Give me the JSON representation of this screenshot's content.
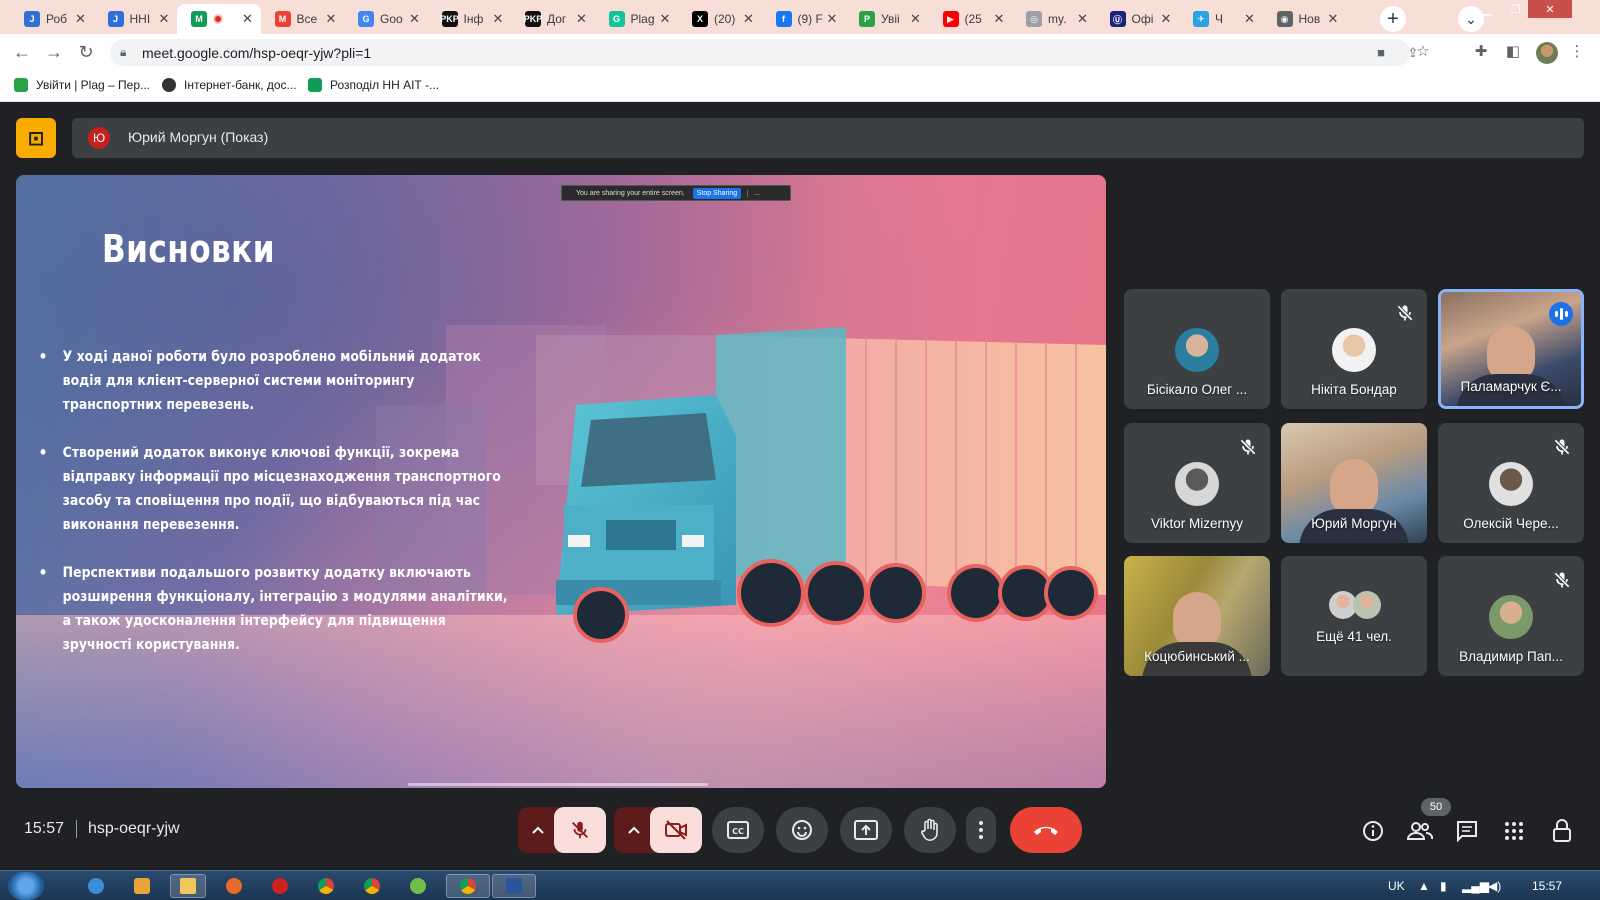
{
  "browser": {
    "tabs": [
      {
        "title": "Роб",
        "favicon": "jira-icon",
        "color": "#2f6fd6",
        "glyph": "J"
      },
      {
        "title": "ННІ",
        "favicon": "jira-icon",
        "color": "#2f6fd6",
        "glyph": "J"
      },
      {
        "title": "",
        "favicon": "meet-icon",
        "color": "#0f9d58",
        "glyph": "M",
        "recording": true
      },
      {
        "title": "Все",
        "favicon": "gmail-icon",
        "color": "#ea4335",
        "glyph": "M"
      },
      {
        "title": "Goo",
        "favicon": "google-translate-icon",
        "color": "#4285f4",
        "glyph": "G"
      },
      {
        "title": "Інф",
        "favicon": "pkp-icon",
        "color": "#111111",
        "glyph": "PKP"
      },
      {
        "title": "Дог",
        "favicon": "pkp-icon",
        "color": "#111111",
        "glyph": "PKP"
      },
      {
        "title": "Plag",
        "favicon": "grammarly-icon",
        "color": "#15c39a",
        "glyph": "G"
      },
      {
        "title": "(20)",
        "favicon": "x-icon",
        "color": "#000000",
        "glyph": "X"
      },
      {
        "title": "(9) F",
        "favicon": "facebook-icon",
        "color": "#1877f2",
        "glyph": "f"
      },
      {
        "title": "Увіі",
        "favicon": "plag-icon",
        "color": "#2aa245",
        "glyph": "P"
      },
      {
        "title": "(25",
        "favicon": "youtube-icon",
        "color": "#ff0000",
        "glyph": "▶"
      },
      {
        "title": "my.",
        "favicon": "globe-icon",
        "color": "#9aa0a6",
        "glyph": "◎"
      },
      {
        "title": "Офі",
        "favicon": "ukraine-icon",
        "color": "#1a237e",
        "glyph": "Ⓤ"
      },
      {
        "title": "Ч",
        "favicon": "telegram-icon",
        "color": "#2aa3e0",
        "glyph": "✈"
      },
      {
        "title": "Нов",
        "favicon": "chrome-icon",
        "color": "#5f6368",
        "glyph": "◉"
      }
    ],
    "url": "meet.google.com/hsp-oeqr-yjw?pli=1",
    "bookmarks": [
      {
        "label": "Увійти | Plag – Пер...",
        "icon": "plag-icon",
        "color": "#2aa245"
      },
      {
        "label": "Інтернет-банк, дос...",
        "icon": "bank24-icon",
        "color": "#333333"
      },
      {
        "label": "Розподіл НН АІТ -...",
        "icon": "sheets-icon",
        "color": "#0f9d58"
      }
    ]
  },
  "meet": {
    "presenter_initial": "Ю",
    "presenter_label": "Юрий Моргун (Показ)",
    "share_banner": {
      "text": "You are sharing your entire screen.",
      "stop": "Stop Sharing",
      "hide": "..."
    },
    "slide": {
      "title": "Висновки",
      "bullets": [
        "У ході даної роботи було розроблено мобільний додаток водія для клієнт-серверної системи моніторингу транспортних перевезень.",
        "Створений додаток виконує ключові функції, зокрема відправку інформації про місцезнаходження транспортного засобу та сповіщення про події, що відбуваються під час виконання перевезення.",
        "Перспективи подальшого розвитку додатку включають розширення функціоналу, інтеграцію з модулями аналітики, а також удосконалення інтерфейсу для підвищення зручності користування."
      ]
    },
    "participants": [
      {
        "name": "Бісікало Олег ...",
        "muted": false,
        "video": false
      },
      {
        "name": "Нікіта Бондар",
        "muted": true,
        "video": false
      },
      {
        "name": "Паламарчук Є...",
        "muted": false,
        "video": true,
        "speaking": true
      },
      {
        "name": "Viktor Mizernyy",
        "muted": true,
        "video": false
      },
      {
        "name": "Юрий Моргун",
        "muted": false,
        "video": true
      },
      {
        "name": "Олексій Чере...",
        "muted": true,
        "video": false
      },
      {
        "name": "Коцюбинський ...",
        "muted": false,
        "video": true
      },
      {
        "name": "Ещё 41 чел.",
        "muted": false,
        "video": false
      },
      {
        "name": "Владимир Пап...",
        "muted": true,
        "video": false
      }
    ],
    "time": "15:57",
    "meeting_code": "hsp-oeqr-yjw",
    "participant_count": "50",
    "accent_leave": "#ea4335"
  },
  "taskbar": {
    "lang": "UK",
    "clock": "15:57"
  }
}
